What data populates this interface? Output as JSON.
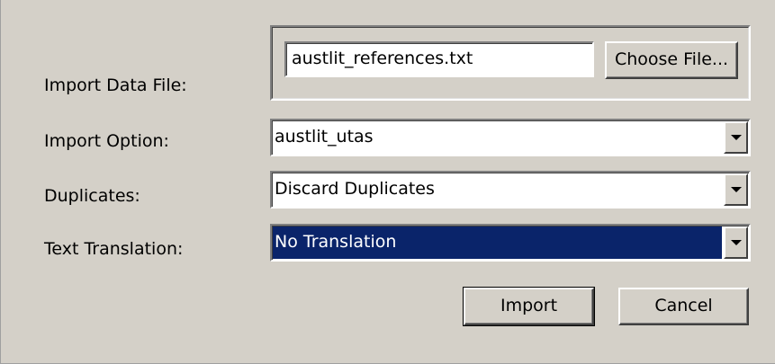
{
  "form": {
    "import_data_file": {
      "label": "Import Data File:",
      "value": "austlit_references.txt",
      "choose_button": "Choose File..."
    },
    "import_option": {
      "label": "Import Option:",
      "value": "austlit_utas"
    },
    "duplicates": {
      "label": "Duplicates:",
      "value": "Discard Duplicates"
    },
    "text_translation": {
      "label": "Text Translation:",
      "value": "No Translation"
    }
  },
  "buttons": {
    "import": "Import",
    "cancel": "Cancel"
  },
  "icons": {
    "dropdown": "chevron-down-icon"
  },
  "colors": {
    "background": "#d4d0c8",
    "selection": "#0a246a",
    "selection_text": "#ffffff"
  }
}
